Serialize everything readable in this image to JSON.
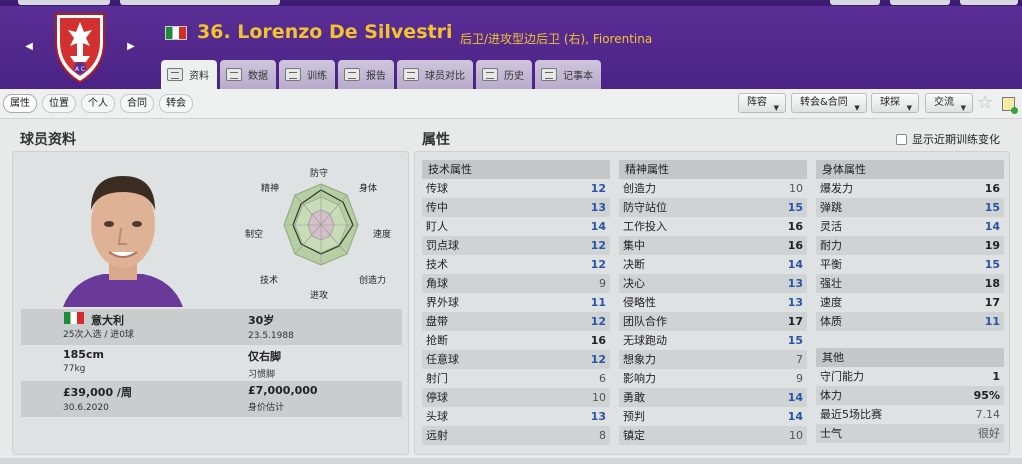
{
  "header": {
    "player_number_name": "36. Lorenzo De Silvestri",
    "subtitle": "后卫/进攻型边后卫 (右), Fiorentina",
    "crest_letters": "A C",
    "tabs": [
      {
        "label": "资料",
        "active": true
      },
      {
        "label": "数据",
        "active": false
      },
      {
        "label": "训练",
        "active": false
      },
      {
        "label": "报告",
        "active": false
      },
      {
        "label": "球员对比",
        "active": false
      },
      {
        "label": "历史",
        "active": false
      },
      {
        "label": "记事本",
        "active": false
      }
    ],
    "colors": {
      "header_bg": "#4b2385",
      "name_gold": "#f2c230"
    }
  },
  "subbar": {
    "tabs": [
      "属性",
      "位置",
      "个人",
      "合同",
      "转会"
    ],
    "actions": [
      "阵容",
      "转会&合同",
      "球探",
      "交流"
    ]
  },
  "profile": {
    "title": "球员资料",
    "radar_labels": [
      "防守",
      "身体",
      "速度",
      "创造力",
      "进攻",
      "技术",
      "制空",
      "精神"
    ],
    "nationality": "意大利",
    "caps": "25次入选 / 进0球",
    "age": "30岁",
    "dob": "23.5.1988",
    "height": "185cm",
    "weight": "77kg",
    "foot": "仅右脚",
    "foot_label": "习惯脚",
    "wage": "£39,000 /周",
    "contract_end": "30.6.2020",
    "value": "£7,000,000",
    "value_label": "身价估计"
  },
  "attributes": {
    "title": "属性",
    "show_recent_label": "显示近期训练变化",
    "technical": {
      "header": "技术属性",
      "items": [
        {
          "label": "传球",
          "value": "12"
        },
        {
          "label": "传中",
          "value": "13"
        },
        {
          "label": "盯人",
          "value": "14"
        },
        {
          "label": "罚点球",
          "value": "12"
        },
        {
          "label": "技术",
          "value": "12"
        },
        {
          "label": "角球",
          "value": "9"
        },
        {
          "label": "界外球",
          "value": "11"
        },
        {
          "label": "盘带",
          "value": "12"
        },
        {
          "label": "抢断",
          "value": "16"
        },
        {
          "label": "任意球",
          "value": "12"
        },
        {
          "label": "射门",
          "value": "6"
        },
        {
          "label": "停球",
          "value": "10"
        },
        {
          "label": "头球",
          "value": "13"
        },
        {
          "label": "远射",
          "value": "8"
        }
      ]
    },
    "mental": {
      "header": "精神属性",
      "items": [
        {
          "label": "创造力",
          "value": "10"
        },
        {
          "label": "防守站位",
          "value": "15"
        },
        {
          "label": "工作投入",
          "value": "16"
        },
        {
          "label": "集中",
          "value": "16"
        },
        {
          "label": "决断",
          "value": "14"
        },
        {
          "label": "决心",
          "value": "13"
        },
        {
          "label": "侵略性",
          "value": "13"
        },
        {
          "label": "团队合作",
          "value": "17"
        },
        {
          "label": "无球跑动",
          "value": "15"
        },
        {
          "label": "想象力",
          "value": "7"
        },
        {
          "label": "影响力",
          "value": "9"
        },
        {
          "label": "勇敢",
          "value": "14"
        },
        {
          "label": "预判",
          "value": "14"
        },
        {
          "label": "镇定",
          "value": "10"
        }
      ]
    },
    "physical": {
      "header": "身体属性",
      "items": [
        {
          "label": "爆发力",
          "value": "16"
        },
        {
          "label": "弹跳",
          "value": "15"
        },
        {
          "label": "灵活",
          "value": "14"
        },
        {
          "label": "耐力",
          "value": "19"
        },
        {
          "label": "平衡",
          "value": "15"
        },
        {
          "label": "强壮",
          "value": "18"
        },
        {
          "label": "速度",
          "value": "17"
        },
        {
          "label": "体质",
          "value": "11"
        }
      ]
    },
    "other": {
      "header": "其他",
      "items": [
        {
          "label": "守门能力",
          "value": "1"
        },
        {
          "label": "体力",
          "value": "95%"
        },
        {
          "label": "最近5场比赛",
          "value": "7.14"
        },
        {
          "label": "士气",
          "value": "很好"
        }
      ]
    }
  }
}
